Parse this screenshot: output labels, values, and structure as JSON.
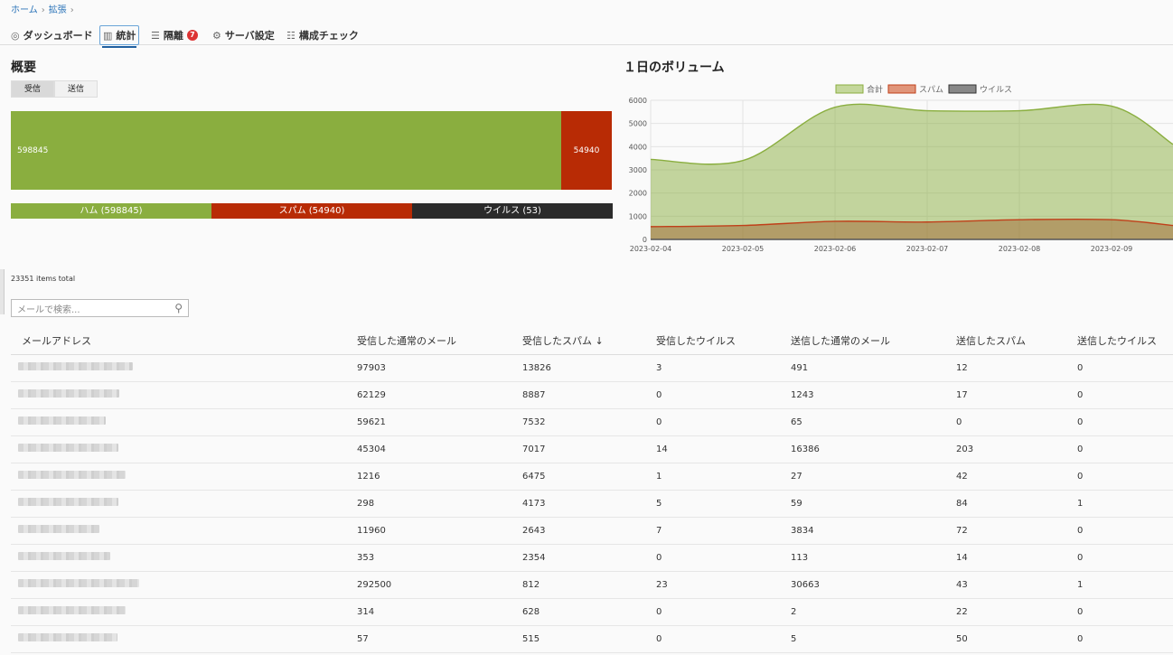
{
  "breadcrumb": {
    "home": "ホーム",
    "ext": "拡張"
  },
  "tabs": [
    {
      "label": "ダッシュボード",
      "icon": "dashboard-icon"
    },
    {
      "label": "統計",
      "icon": "stats-icon"
    },
    {
      "label": "隔離",
      "icon": "list-icon",
      "badge": "7"
    },
    {
      "label": "サーバ設定",
      "icon": "gear-icon"
    },
    {
      "label": "構成チェック",
      "icon": "check-icon"
    }
  ],
  "overview": {
    "title": "概要",
    "toggle_in": "受信",
    "toggle_out": "送信",
    "ham_value": "598845",
    "spam_value": "54940",
    "legend_ham": "ハム (598845)",
    "legend_spam": "スパム (54940)",
    "legend_virus": "ウイルス (53)"
  },
  "volume": {
    "title": "１日のボリューム"
  },
  "list": {
    "total": "23351 items total",
    "search_placeholder": "メールで検索...",
    "headers": [
      "メールアドレス",
      "受信した通常のメール",
      "受信したスパム ↓",
      "受信したウイルス",
      "送信した通常のメール",
      "送信したスパム",
      "送信したウイルス"
    ],
    "rows": [
      [
        "97903",
        "13826",
        "3",
        "491",
        "12",
        "0"
      ],
      [
        "62129",
        "8887",
        "0",
        "1243",
        "17",
        "0"
      ],
      [
        "59621",
        "7532",
        "0",
        "65",
        "0",
        "0"
      ],
      [
        "45304",
        "7017",
        "14",
        "16386",
        "203",
        "0"
      ],
      [
        "1216",
        "6475",
        "1",
        "27",
        "42",
        "0"
      ],
      [
        "298",
        "4173",
        "5",
        "59",
        "84",
        "1"
      ],
      [
        "11960",
        "2643",
        "7",
        "3834",
        "72",
        "0"
      ],
      [
        "353",
        "2354",
        "0",
        "113",
        "14",
        "0"
      ],
      [
        "292500",
        "812",
        "23",
        "30663",
        "43",
        "1"
      ],
      [
        "314",
        "628",
        "0",
        "2",
        "22",
        "0"
      ],
      [
        "57",
        "515",
        "0",
        "5",
        "50",
        "0"
      ]
    ]
  },
  "colors": {
    "ham": "#8aae3f",
    "spam": "#b82b05",
    "virus": "#2b2b2b"
  },
  "chart_data": {
    "type": "area",
    "title": "１日のボリューム",
    "x": [
      "2023-02-04",
      "2023-02-05",
      "2023-02-06",
      "2023-02-07",
      "2023-02-08",
      "2023-02-09"
    ],
    "ylim": [
      0,
      6000
    ],
    "yticks": [
      0,
      1000,
      2000,
      3000,
      4000,
      5000,
      6000
    ],
    "grid": true,
    "legend_position": "top",
    "series": [
      {
        "name": "合計",
        "values": [
          3450,
          3400,
          5700,
          5550,
          5550,
          5750
        ],
        "color": "#8aae3f"
      },
      {
        "name": "スパム",
        "values": [
          550,
          600,
          780,
          750,
          850,
          850
        ],
        "color": "#c0401a"
      },
      {
        "name": "ウイルス",
        "values": [
          0,
          0,
          0,
          0,
          0,
          0
        ],
        "color": "#555555"
      }
    ]
  }
}
